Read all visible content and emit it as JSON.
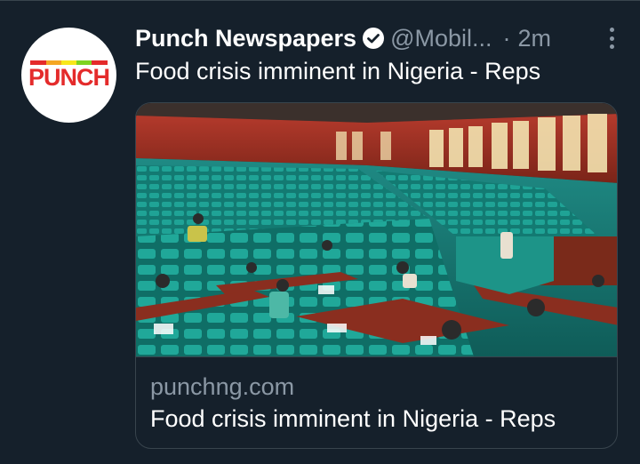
{
  "tweet": {
    "author": {
      "display_name": "Punch Newspapers",
      "handle": "@Mobil...",
      "avatar_logo_text": "PUNCH",
      "verified_icon": "verified-badge-icon"
    },
    "separator": "·",
    "timestamp": "2m",
    "more_icon": "more-options-icon",
    "text": "Food crisis imminent in Nigeria - Reps"
  },
  "link_card": {
    "image_icon": "parliament-chamber-photo",
    "domain": "punchng.com",
    "title": "Food crisis imminent in Nigeria - Reps"
  },
  "colors": {
    "background": "#15202b",
    "border": "#38444d",
    "text_primary": "#ffffff",
    "text_secondary": "#8b98a5",
    "brand_red": "#e42b2b"
  }
}
